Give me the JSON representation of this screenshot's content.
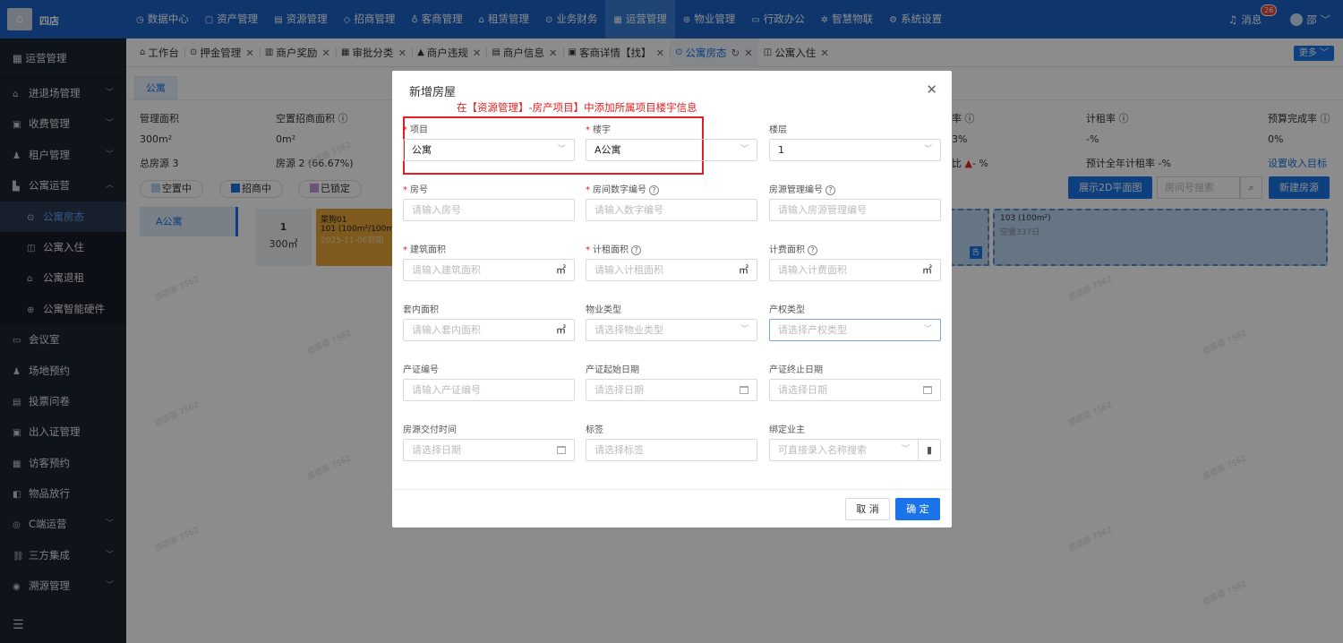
{
  "app": {
    "brand": "四店",
    "logo_icon": "building-logo-icon"
  },
  "topnav": [
    {
      "label": "数据中心",
      "icon": "chart-icon"
    },
    {
      "label": "资产管理",
      "icon": "box-icon"
    },
    {
      "label": "资源管理",
      "icon": "document-icon"
    },
    {
      "label": "招商管理",
      "icon": "tag-icon"
    },
    {
      "label": "客商管理",
      "icon": "users-icon"
    },
    {
      "label": "租赁管理",
      "icon": "home-icon"
    },
    {
      "label": "业务财务",
      "icon": "coin-icon"
    },
    {
      "label": "运营管理",
      "icon": "grid-icon",
      "active": true
    },
    {
      "label": "物业管理",
      "icon": "service-icon"
    },
    {
      "label": "行政办公",
      "icon": "chat-icon"
    },
    {
      "label": "智慧物联",
      "icon": "sparkle-icon"
    },
    {
      "label": "系统设置",
      "icon": "gear-icon"
    }
  ],
  "user": {
    "messages_label": "消息",
    "message_count": "26",
    "name": "邵"
  },
  "sidebar": {
    "header": "运营管理",
    "items": [
      {
        "label": "进退场管理",
        "arrow": "﹀"
      },
      {
        "label": "收费管理",
        "arrow": "﹀"
      },
      {
        "label": "租户管理",
        "arrow": "﹀"
      },
      {
        "label": "公寓运营",
        "arrow": "︿"
      },
      {
        "label": "公寓房态",
        "sub": true,
        "active": true
      },
      {
        "label": "公寓入住",
        "sub": true
      },
      {
        "label": "公寓退租",
        "sub": true
      },
      {
        "label": "公寓智能硬件",
        "sub": true
      },
      {
        "label": "会议室"
      },
      {
        "label": "场地预约"
      },
      {
        "label": "投票问卷"
      },
      {
        "label": "出入证管理"
      },
      {
        "label": "访客预约"
      },
      {
        "label": "物品放行"
      },
      {
        "label": "C端运营",
        "arrow": "﹀"
      },
      {
        "label": "三方集成",
        "arrow": "﹀"
      },
      {
        "label": "溯源管理",
        "arrow": "﹀"
      }
    ],
    "collapse_icon": "☰"
  },
  "tabs": [
    {
      "label": "工作台"
    },
    {
      "label": "押金管理"
    },
    {
      "label": "商户奖励"
    },
    {
      "label": "审批分类"
    },
    {
      "label": "商户违规"
    },
    {
      "label": "商户信息"
    },
    {
      "label": "客商详情【找】"
    },
    {
      "label": "公寓房态",
      "active": true
    },
    {
      "label": "公寓入住"
    }
  ],
  "more_label": "更多 ﹀",
  "page": {
    "tab": "公寓",
    "stats": {
      "area_label": "管理面积",
      "area_value": "300m²",
      "vacant_label": "空置招商面积 ⓘ",
      "vacant_value": "0m²",
      "total_label": "总房源 3",
      "rooms_label": "房源 2 (66.67%)",
      "rate_label": "率 ⓘ",
      "rate_value": "3%",
      "rent_label": "计租率 ⓘ",
      "rent_value": "-%",
      "budget_label": "预算完成率 ⓘ",
      "budget_value": "0%",
      "ratio_label": "比",
      "ratio_value": "- %",
      "forecast_label": "预计全年计租率 -%",
      "target_link": "设置收入目标"
    },
    "legend": [
      {
        "label": "空置中",
        "color": "#b7d3ef"
      },
      {
        "label": "招商中",
        "color": "#1a73e8"
      },
      {
        "label": "已锁定",
        "color": "#c39be0"
      }
    ],
    "btn_2d": "展示2D平面图",
    "search_placeholder": "房间号搜索",
    "btn_new": "新建房源",
    "building": "A公寓",
    "floor": {
      "number": "1",
      "area": "300㎡"
    },
    "room_101": {
      "tenant": "菜狗01",
      "info": "101 (100m²/100m²",
      "date": "2025-11-06到期"
    },
    "room_103": {
      "info": "103 (100m²)",
      "status": "空置337日"
    },
    "watermark": "邵邵邵 7562"
  },
  "modal": {
    "title": "新增房屋",
    "annotation": "在【资源管理】-房产项目】中添加所属项目楼宇信息",
    "fields": {
      "project": {
        "label": "项目",
        "value": "公寓"
      },
      "building": {
        "label": "楼宇",
        "value": "A公寓"
      },
      "floor": {
        "label": "楼层",
        "value": "1"
      },
      "room_no": {
        "label": "房号",
        "placeholder": "请输入房号"
      },
      "room_digit": {
        "label": "房间数字编号",
        "placeholder": "请输入数字编号"
      },
      "mgmt_no": {
        "label": "房源管理编号",
        "placeholder": "请输入房源管理编号"
      },
      "build_area": {
        "label": "建筑面积",
        "placeholder": "请输入建筑面积",
        "unit": "㎡"
      },
      "rent_area": {
        "label": "计租面积",
        "placeholder": "请输入计租面积",
        "unit": "㎡"
      },
      "fee_area": {
        "label": "计费面积",
        "placeholder": "请输入计费面积",
        "unit": "㎡"
      },
      "inner_area": {
        "label": "套内面积",
        "placeholder": "请输入套内面积",
        "unit": "㎡"
      },
      "property_type": {
        "label": "物业类型",
        "placeholder": "请选择物业类型"
      },
      "ownership_type": {
        "label": "产权类型",
        "placeholder": "请选择产权类型"
      },
      "cert_no": {
        "label": "产证编号",
        "placeholder": "请输入产证编号"
      },
      "cert_start": {
        "label": "产证起始日期",
        "placeholder": "请选择日期"
      },
      "cert_end": {
        "label": "产证终止日期",
        "placeholder": "请选择日期"
      },
      "delivery_time": {
        "label": "房源交付时间",
        "placeholder": "请选择日期"
      },
      "tags": {
        "label": "标签",
        "placeholder": "请选择标签"
      },
      "owner": {
        "label": "绑定业主",
        "placeholder": "可直接录入名称搜索"
      }
    },
    "cancel": "取 消",
    "ok": "确 定"
  }
}
